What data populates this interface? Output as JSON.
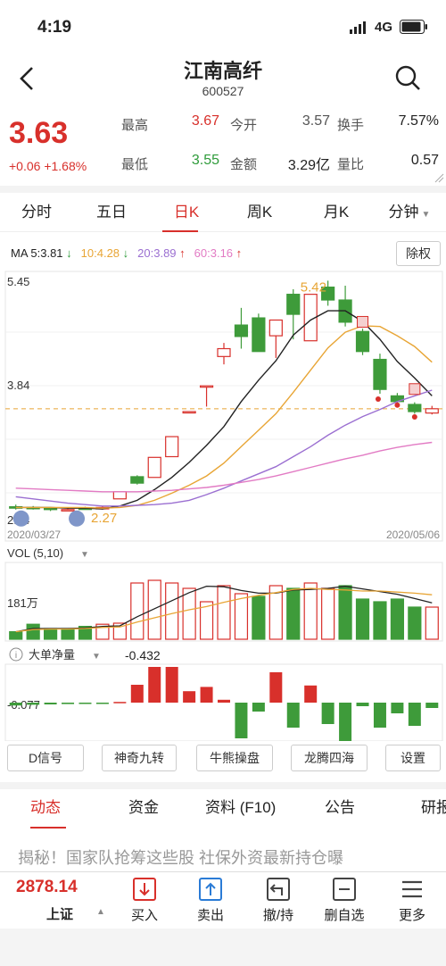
{
  "status": {
    "time": "4:19",
    "network": "4G"
  },
  "header": {
    "title": "江南高纤",
    "code": "600527"
  },
  "quote": {
    "price": "3.63",
    "change": "+0.06 +1.68%",
    "stats": [
      {
        "label": "最高",
        "value": "3.67",
        "color": "#d8302b"
      },
      {
        "label": "今开",
        "value": "3.57",
        "color": "#555555"
      },
      {
        "label": "换手",
        "value": "7.57%",
        "color": "#222222"
      },
      {
        "label": "最低",
        "value": "3.55",
        "color": "#2e9b3a"
      },
      {
        "label": "金额",
        "value": "3.29亿",
        "color": "#222222"
      },
      {
        "label": "量比",
        "value": "0.57",
        "color": "#222222"
      }
    ]
  },
  "tabs": [
    "分时",
    "五日",
    "日K",
    "周K",
    "月K",
    "分钟"
  ],
  "active_tab": "日K",
  "ma": [
    {
      "label": "MA 5:3.81",
      "arrow": "↓",
      "color": "#222222",
      "arrow_color": "#2e9b3a"
    },
    {
      "label": "10:4.28",
      "arrow": "↓",
      "color": "#e8a535",
      "arrow_color": "#2e9b3a"
    },
    {
      "label": "20:3.89",
      "arrow": "↑",
      "color": "#9b6fd1",
      "arrow_color": "#d8302b"
    },
    {
      "label": "60:3.16",
      "arrow": "↑",
      "color": "#e27bc4",
      "arrow_color": "#d8302b"
    }
  ],
  "fuquan_label": "除权",
  "chart_data": [
    {
      "type": "candlestick",
      "y_top_label": "5.45",
      "y_mid_label": "3.84",
      "price_range": [
        2.13,
        5.45
      ],
      "high_label": "5.42",
      "low_label": "2.27",
      "left_low_label": "2.24",
      "date_start": "2020/03/27",
      "date_end": "2020/05/06",
      "current_price_line": 3.63,
      "candles": [
        {
          "o": 2.26,
          "c": 2.24,
          "h": 2.29,
          "l": 2.22
        },
        {
          "o": 2.25,
          "c": 2.24,
          "h": 2.27,
          "l": 2.22
        },
        {
          "o": 2.24,
          "c": 2.22,
          "h": 2.25,
          "l": 2.2
        },
        {
          "o": 2.22,
          "c": 2.22,
          "h": 2.24,
          "l": 2.2
        },
        {
          "o": 2.24,
          "c": 2.23,
          "h": 2.26,
          "l": 2.22
        },
        {
          "o": 2.23,
          "c": 2.25,
          "h": 2.27,
          "l": 2.22
        },
        {
          "o": 2.37,
          "c": 2.47,
          "h": 2.47,
          "l": 2.37
        },
        {
          "o": 2.68,
          "c": 2.59,
          "h": 2.7,
          "l": 2.57
        },
        {
          "o": 2.67,
          "c": 2.95,
          "h": 2.95,
          "l": 2.67
        },
        {
          "o": 2.96,
          "c": 3.24,
          "h": 3.24,
          "l": 2.96
        },
        {
          "o": 3.58,
          "c": 3.59,
          "h": 3.59,
          "l": 3.58
        },
        {
          "o": 3.95,
          "c": 3.95,
          "h": 3.95,
          "l": 3.66
        },
        {
          "o": 4.36,
          "c": 4.47,
          "h": 4.55,
          "l": 4.25
        },
        {
          "o": 4.8,
          "c": 4.64,
          "h": 5.04,
          "l": 4.47
        },
        {
          "o": 4.9,
          "c": 4.43,
          "h": 4.96,
          "l": 4.43
        },
        {
          "o": 4.65,
          "c": 4.87,
          "h": 4.87,
          "l": 4.34
        },
        {
          "o": 5.23,
          "c": 4.95,
          "h": 5.3,
          "l": 4.6
        },
        {
          "o": 4.58,
          "c": 5.23,
          "h": 5.23,
          "l": 4.58
        },
        {
          "o": 5.33,
          "c": 5.15,
          "h": 5.42,
          "l": 5.07
        },
        {
          "o": 5.15,
          "c": 4.84,
          "h": 5.35,
          "l": 4.78
        },
        {
          "o": 4.71,
          "c": 4.43,
          "h": 4.75,
          "l": 4.38
        },
        {
          "o": 4.32,
          "c": 3.9,
          "h": 4.4,
          "l": 3.84
        },
        {
          "o": 3.81,
          "c": 3.73,
          "h": 3.85,
          "l": 3.66
        },
        {
          "o": 3.69,
          "c": 3.59,
          "h": 3.72,
          "l": 3.56
        },
        {
          "o": 3.57,
          "c": 3.63,
          "h": 3.67,
          "l": 3.55
        }
      ],
      "ma_lines": [
        {
          "name": "MA5",
          "color": "#222222",
          "values": [
            2.25,
            2.25,
            2.25,
            2.24,
            2.24,
            2.23,
            2.27,
            2.35,
            2.5,
            2.67,
            2.88,
            3.12,
            3.38,
            3.73,
            4.03,
            4.3,
            4.66,
            4.87,
            5.0,
            5.0,
            4.85,
            4.6,
            4.29,
            4.06,
            3.81
          ]
        },
        {
          "name": "MA10",
          "color": "#e8a535",
          "values": [
            2.25,
            2.25,
            2.25,
            2.25,
            2.25,
            2.24,
            2.25,
            2.28,
            2.35,
            2.45,
            2.56,
            2.69,
            2.87,
            3.1,
            3.33,
            3.56,
            3.86,
            4.17,
            4.48,
            4.7,
            4.79,
            4.78,
            4.65,
            4.5,
            4.28
          ]
        },
        {
          "name": "MA20",
          "color": "#9b6fd1",
          "values": [
            2.4,
            2.37,
            2.34,
            2.31,
            2.29,
            2.27,
            2.27,
            2.28,
            2.29,
            2.31,
            2.35,
            2.43,
            2.52,
            2.62,
            2.72,
            2.82,
            2.96,
            3.1,
            3.26,
            3.4,
            3.52,
            3.62,
            3.73,
            3.81,
            3.89
          ]
        },
        {
          "name": "MA60",
          "color": "#e27bc4",
          "values": [
            2.52,
            2.51,
            2.5,
            2.49,
            2.48,
            2.47,
            2.47,
            2.47,
            2.48,
            2.49,
            2.51,
            2.53,
            2.56,
            2.6,
            2.64,
            2.69,
            2.75,
            2.81,
            2.87,
            2.93,
            2.98,
            3.04,
            3.09,
            3.13,
            3.16
          ]
        }
      ]
    },
    {
      "type": "bar",
      "title": "VOL (5,10)",
      "y_label": "181万",
      "values": [
        0.14,
        0.28,
        0.2,
        0.2,
        0.24,
        0.28,
        0.3,
        1.05,
        1.1,
        1.05,
        0.95,
        0.7,
        1.0,
        0.85,
        0.8,
        1.0,
        0.95,
        1.05,
        0.95,
        1.0,
        0.75,
        0.7,
        0.75,
        0.6,
        0.6
      ],
      "up": [
        false,
        false,
        false,
        false,
        false,
        true,
        true,
        true,
        true,
        true,
        true,
        true,
        true,
        true,
        false,
        true,
        false,
        true,
        true,
        false,
        false,
        false,
        false,
        false,
        true
      ],
      "ma_lines": [
        {
          "name": "MA5",
          "color": "#222222",
          "values": [
            0.14,
            0.2,
            0.2,
            0.2,
            0.21,
            0.24,
            0.25,
            0.42,
            0.57,
            0.72,
            0.87,
            0.99,
            0.98,
            0.91,
            0.86,
            0.86,
            0.92,
            0.93,
            0.95,
            0.99,
            0.94,
            0.89,
            0.84,
            0.76,
            0.68
          ]
        },
        {
          "name": "MA10",
          "color": "#e8a535",
          "values": [
            0.14,
            0.18,
            0.19,
            0.19,
            0.2,
            0.22,
            0.23,
            0.32,
            0.4,
            0.48,
            0.55,
            0.61,
            0.69,
            0.76,
            0.82,
            0.87,
            0.93,
            0.95,
            0.93,
            0.92,
            0.9,
            0.9,
            0.88,
            0.86,
            0.83
          ]
        }
      ]
    },
    {
      "type": "bar",
      "title": "大单净量",
      "value_label": "-0.432",
      "y_label": "-0.077",
      "values": [
        -0.08,
        -0.06,
        -0.05,
        -0.04,
        -0.02,
        -0.02,
        0.02,
        0.5,
        1.0,
        1.0,
        0.32,
        0.44,
        0.08,
        -1.0,
        -0.25,
        0.85,
        -0.7,
        0.48,
        -0.6,
        -1.1,
        -0.1,
        -0.7,
        -0.3,
        -0.65,
        -0.15
      ]
    }
  ],
  "indicator_buttons": [
    "D信号",
    "神奇九转",
    "牛熊操盘",
    "龙腾四海",
    "设置"
  ],
  "news_tabs": [
    "动态",
    "资金",
    "资料 (F10)",
    "公告",
    "研报"
  ],
  "active_news_tab": "动态",
  "news_headline": "揭秘！国家队抢筹这些股 社保外资最新持仓曝",
  "index": {
    "value": "2878.14",
    "name": "上证"
  },
  "toolbar": [
    "买入",
    "卖出",
    "撤/持",
    "删自选",
    "更多"
  ]
}
